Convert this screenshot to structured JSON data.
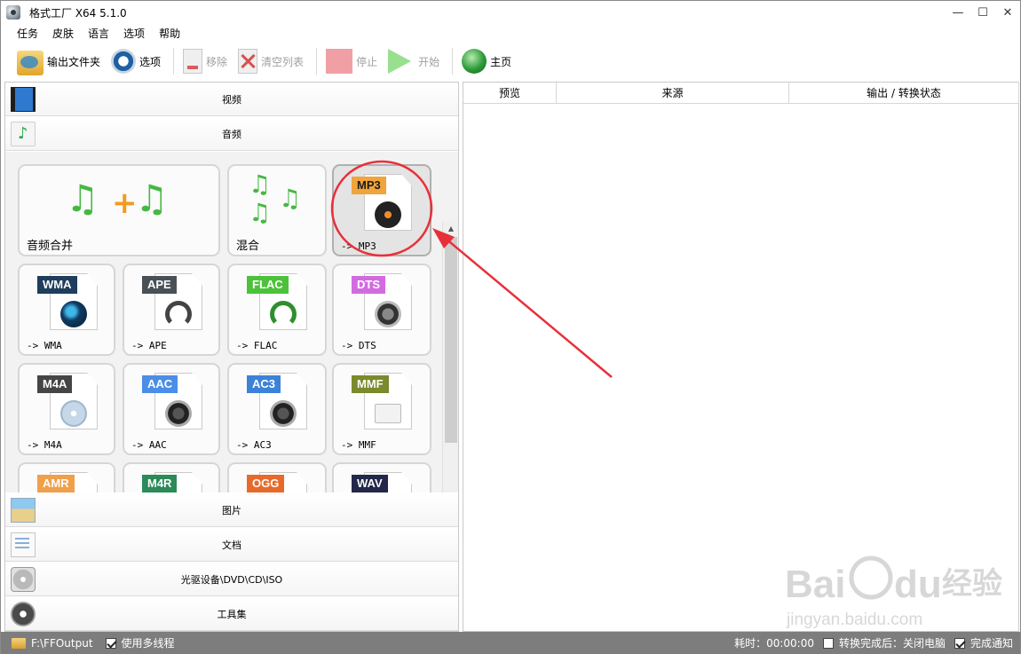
{
  "window": {
    "title": "格式工厂 X64 5.1.0",
    "controls": {
      "minimize": "—",
      "maximize": "☐",
      "close": "✕"
    }
  },
  "menu": [
    "任务",
    "皮肤",
    "语言",
    "选项",
    "帮助"
  ],
  "toolbar": {
    "output_folder": "输出文件夹",
    "options": "选项",
    "remove": "移除",
    "clear_list": "清空列表",
    "stop": "停止",
    "start": "开始",
    "home": "主页"
  },
  "categories": {
    "video": "视频",
    "audio": "音频",
    "image": "图片",
    "document": "文档",
    "disc": "光驱设备\\DVD\\CD\\ISO",
    "tools": "工具集"
  },
  "audio_tools": {
    "merge": "音频合并",
    "mix": "混合"
  },
  "formats": [
    {
      "badge": "MP3",
      "label": "-> MP3",
      "color": "#f0a43a",
      "icon": "vinyl-disc-icon"
    },
    {
      "badge": "WMA",
      "label": "-> WMA",
      "color": "#1f3d5c",
      "icon": "media-player-icon"
    },
    {
      "badge": "APE",
      "label": "-> APE",
      "color": "#4a5058",
      "icon": "headphones-icon"
    },
    {
      "badge": "FLAC",
      "label": "-> FLAC",
      "color": "#4cc23a",
      "icon": "headphones-icon"
    },
    {
      "badge": "DTS",
      "label": "-> DTS",
      "color": "#d26be0",
      "icon": "speaker-icon"
    },
    {
      "badge": "M4A",
      "label": "-> M4A",
      "color": "#454545",
      "icon": "music-cd-icon"
    },
    {
      "badge": "AAC",
      "label": "-> AAC",
      "color": "#4a8ee8",
      "icon": "speaker-note-icon"
    },
    {
      "badge": "AC3",
      "label": "-> AC3",
      "color": "#3b82d8",
      "icon": "speaker-note-icon"
    },
    {
      "badge": "MMF",
      "label": "-> MMF",
      "color": "#7a8a2c",
      "icon": "mail-icon"
    },
    {
      "badge": "AMR",
      "label": "",
      "color": "#f0a04a"
    },
    {
      "badge": "M4R",
      "label": "",
      "color": "#2c8a5a"
    },
    {
      "badge": "OGG",
      "label": "",
      "color": "#e86a2a"
    },
    {
      "badge": "WAV",
      "label": "",
      "color": "#23284a"
    }
  ],
  "task_table": {
    "columns": [
      "预览",
      "来源",
      "输出 / 转换状态"
    ]
  },
  "status": {
    "output_path": "F:\\FFOutput",
    "multithread_label": "使用多线程",
    "multithread_checked": true,
    "elapsed": "耗时：00:00:00",
    "after_convert": "转换完成后：关闭电脑",
    "after_convert_checked": false,
    "notify": "完成通知",
    "notify_checked": true
  },
  "annotation_color": "#e8303a",
  "watermark": "Baidu经验 jingyan.baidu.com"
}
